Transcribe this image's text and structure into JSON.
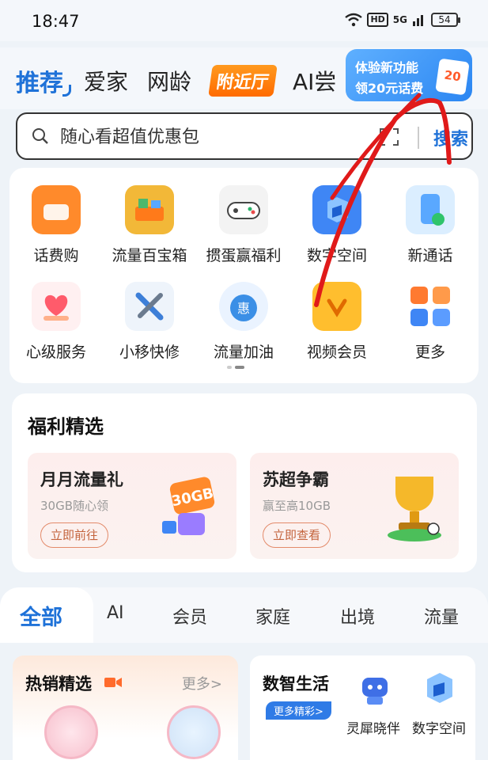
{
  "status_bar": {
    "time": "18:47",
    "hd": "HD",
    "signal": "5G",
    "battery": "54"
  },
  "top_tabs": [
    "推荐",
    "爱家",
    "网龄",
    "附近厅",
    "AI尝"
  ],
  "promo": {
    "line1": "体验新功能",
    "line2": "领20元话费",
    "ticket": "20"
  },
  "search": {
    "placeholder": "随心看超值优惠包",
    "button": "搜索"
  },
  "services": [
    {
      "label": "话费购",
      "icon": "bill-bag-icon",
      "color": "#ff8a2b"
    },
    {
      "label": "流量百宝箱",
      "icon": "treasure-box-icon",
      "color": "#f2b838"
    },
    {
      "label": "掼蛋赢福利",
      "icon": "gamepad-icon",
      "color": "#eeeeee"
    },
    {
      "label": "数字空间",
      "icon": "cube-space-icon",
      "color": "#3f86f5"
    },
    {
      "label": "新通话",
      "icon": "phone-call-icon",
      "color": "#5aa8ff"
    },
    {
      "label": "心级服务",
      "icon": "heart-hand-icon",
      "color": "#ff5b6b"
    },
    {
      "label": "小移快修",
      "icon": "tools-icon",
      "color": "#3d7fd8"
    },
    {
      "label": "流量加油",
      "icon": "data-boost-icon",
      "color": "#3b8fe6"
    },
    {
      "label": "视频会员",
      "icon": "video-vip-icon",
      "color": "#ffbe2e"
    },
    {
      "label": "更多",
      "icon": "grid-more-icon",
      "color": "#ff7a30"
    }
  ],
  "welfare": {
    "title": "福利精选",
    "cards": [
      {
        "title": "月月流量礼",
        "subtitle": "30GB随心领",
        "button": "立即前往",
        "art": "30GB"
      },
      {
        "title": "苏超争霸",
        "subtitle": "赢至高10GB",
        "button": "立即查看"
      }
    ]
  },
  "categories": [
    "全部",
    "AI",
    "会员",
    "家庭",
    "出境",
    "流量"
  ],
  "hot": {
    "title": "热销精选",
    "more": "更多>"
  },
  "digital_life": {
    "title": "数智生活",
    "tag": "更多精彩>",
    "items": [
      "灵犀晓伴",
      "数字空间"
    ]
  }
}
